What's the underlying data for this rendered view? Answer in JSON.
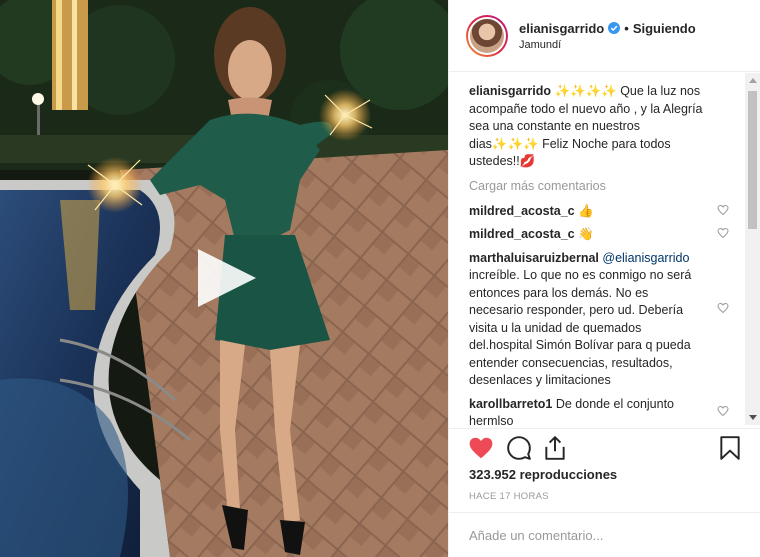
{
  "post": {
    "username": "elianisgarrido",
    "follow_separator": "•",
    "follow_status": "Siguiendo",
    "location": "Jamundí"
  },
  "comments": {
    "caption": {
      "user": "elianisgarrido",
      "text": "✨✨✨✨ Que la luz nos acompañe todo el nuevo año , y la Alegría sea una constante en nuestros dias✨✨✨ Feliz Noche para todos ustedes!!💋"
    },
    "load_more": "Cargar más comentarios",
    "items": [
      {
        "user": "mildred_acosta_c",
        "text": "👍"
      },
      {
        "user": "mildred_acosta_c",
        "text": "👋"
      },
      {
        "user": "marthaluisaruizbernal",
        "mention": "@elianisgarrido",
        "text": "increíble. Lo que no es conmigo no será entonces para los demás. No es necesario responder, pero ud. Debería visita u la unidad de quemados del.hospital Simón Bolívar para q pueda entender consecuencias, resultados, desenlaces y limitaciones"
      },
      {
        "user": "karollbarreto1",
        "text": "De donde el conjunto hermlso"
      }
    ]
  },
  "stats": {
    "views_count": "323.952",
    "views_label": "reproducciones",
    "time_ago": "HACE 17 HORAS"
  },
  "add_comment": {
    "placeholder": "Añade un comentario..."
  },
  "colors": {
    "like_red": "#ed4956",
    "verified_blue": "#3897f0",
    "mention_blue": "#003569"
  },
  "icons": {
    "like": "heart-icon",
    "comment": "comment-icon",
    "share": "share-icon",
    "save": "bookmark-icon",
    "play": "play-icon",
    "verified": "verified-badge-icon"
  }
}
